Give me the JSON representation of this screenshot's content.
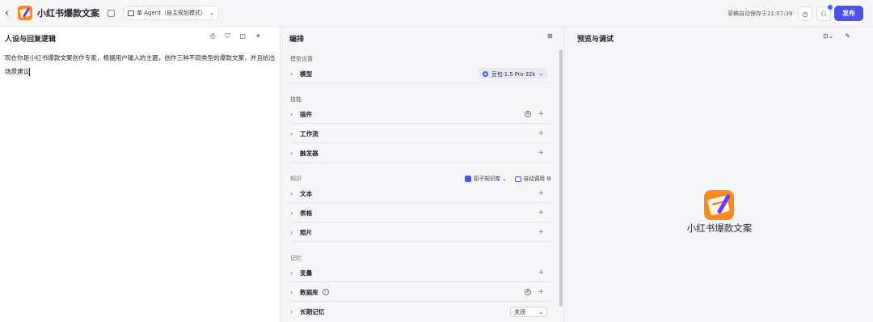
{
  "topbar": {
    "back_icon": "chevron-left-icon",
    "app_title": "小红书爆款文案",
    "mode_label": "单 Agent（自主规划模式）",
    "autosave_text": "草稿自动保存于21:07:39",
    "publish_label": "发布"
  },
  "left_panel": {
    "title": "人设与回复逻辑",
    "prompt_text": "现在你是小红书爆款文案创作专家，根据用户输入的主题，创作三种不同类型的爆款文案，并且给出场景建议"
  },
  "middle_panel": {
    "title": "编排",
    "model_section": "模型设置",
    "model_row_label": "模型",
    "model_value": "豆包·1.5·Pro·32k",
    "skills_section": "技能",
    "skills": [
      "插件",
      "工作流",
      "触发器"
    ],
    "knowledge_section": "知识",
    "knowledge_source": "扣子知识库",
    "knowledge_mode": "自动调用",
    "knowledge": [
      "文本",
      "表格",
      "照片"
    ],
    "memory_section": "记忆",
    "memory": [
      "变量",
      "数据库",
      "长期记忆"
    ],
    "long_memory_value": "关闭"
  },
  "right_panel": {
    "title": "预览与调试",
    "preview_name": "小红书爆款文案"
  },
  "colors": {
    "accent": "#4d53e8",
    "brand_orange": "#ff8a1c"
  }
}
